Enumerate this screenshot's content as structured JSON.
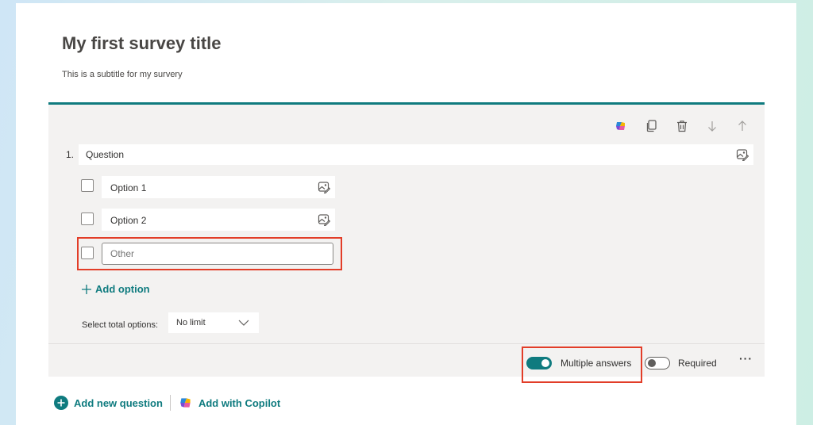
{
  "survey": {
    "title": "My first survey title",
    "subtitle": "This is a subtitle for my survery"
  },
  "question": {
    "number": "1.",
    "text": "Question",
    "options": [
      {
        "label": "Option 1"
      },
      {
        "label": "Option 2"
      }
    ],
    "other_placeholder": "Other",
    "add_option_label": "Add option",
    "select_total_label": "Select total options:",
    "select_total_value": "No limit",
    "multiple_answers_label": "Multiple answers",
    "multiple_answers_on": true,
    "required_label": "Required",
    "required_on": false,
    "more_label": "···"
  },
  "toolbar": {
    "icons": [
      "copilot-icon",
      "copy-icon",
      "delete-icon",
      "move-down-icon",
      "move-up-icon"
    ]
  },
  "actions": {
    "add_new_question": "Add new question",
    "add_with_copilot": "Add with Copilot"
  },
  "colors": {
    "accent": "#0f7b7f",
    "highlight": "#e23d28"
  }
}
